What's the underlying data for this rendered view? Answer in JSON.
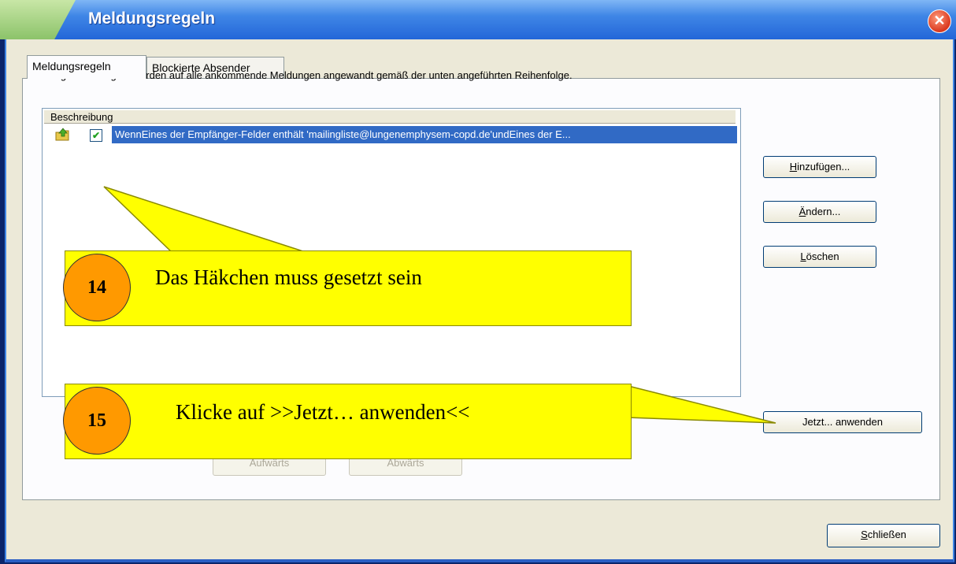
{
  "window": {
    "title": "Meldungsregeln",
    "close_glyph": "✕"
  },
  "tabs": [
    {
      "label": "Meldungsregeln"
    },
    {
      "label": "Blockierte Absender"
    }
  ],
  "description": "Die folgenden Regeln werden auf alle ankommende Meldungen angewandt gemäß der unten angeführten Reihenfolge.",
  "list": {
    "column_header": "Beschreibung",
    "rows": [
      {
        "checked": true,
        "check_glyph": "✔",
        "icon": "rule-icon",
        "text": "WennEines der Empfänger-Felder enthält 'mailingliste@lungenemphysem-copd.de'undEines der E..."
      }
    ]
  },
  "buttons": {
    "add": {
      "underline": "H",
      "rest": "inzufügen..."
    },
    "modify": {
      "underline": "Ä",
      "rest": "ndern..."
    },
    "delete": {
      "underline": "L",
      "rest": "öschen"
    },
    "apply_now": "Jetzt... anwenden",
    "up": "Aufwärts",
    "down": "Abwärts",
    "close": {
      "underline": "S",
      "rest": "chließen"
    }
  },
  "callouts": [
    {
      "number": "14",
      "text": "Das Häkchen muss gesetzt sein"
    },
    {
      "number": "15",
      "text": "Klicke auf >>Jetzt… anwenden<<"
    }
  ],
  "colors": {
    "callout_fill": "#ffff00",
    "badge_fill": "#ff9900",
    "selection": "#316ac5"
  }
}
